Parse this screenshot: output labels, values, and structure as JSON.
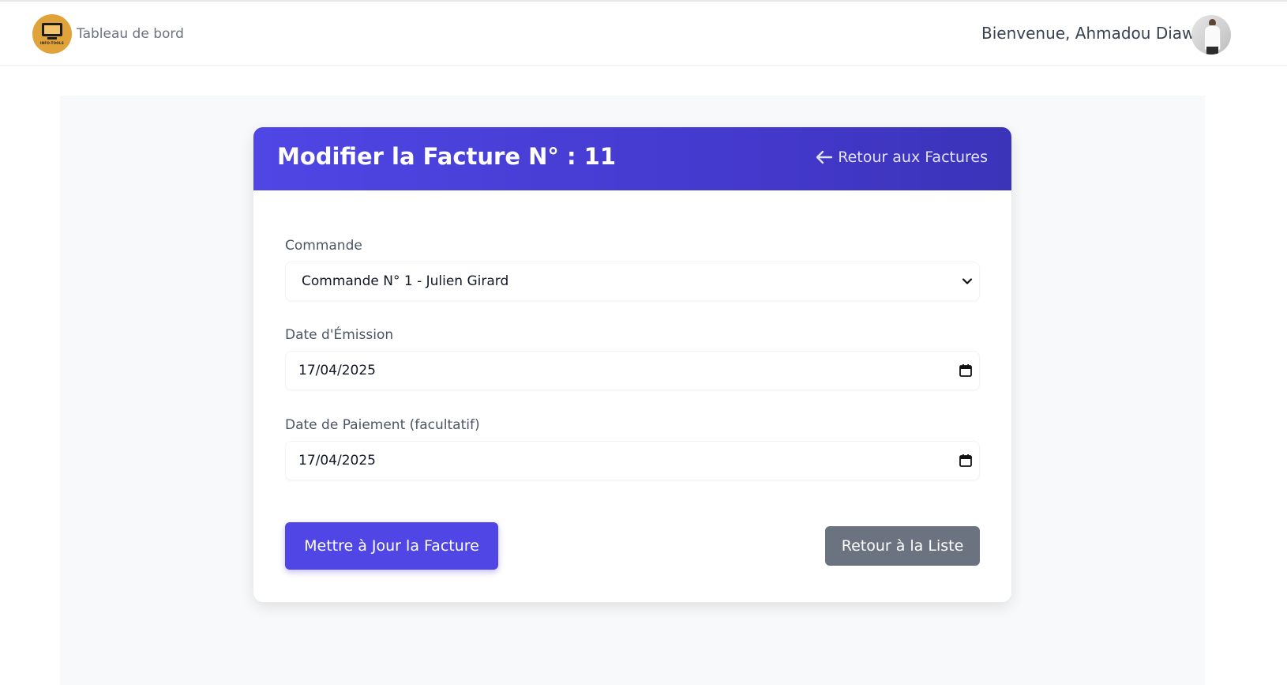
{
  "topbar": {
    "brand_label": "Tableau de bord",
    "logo_text": "INFO-TOOLS",
    "welcome": "Bienvenue, Ahmadou Diaw",
    "avatar_icon": "user-photo",
    "logo_color": "#e0a33a"
  },
  "card": {
    "title": "Modifier la Facture N° : 11",
    "back_link": "Retour aux Factures",
    "header_color": "#4f46e5"
  },
  "form": {
    "commande": {
      "label": "Commande",
      "value": "Commande N° 1 - Julien Girard"
    },
    "date_emission": {
      "label": "Date d'Émission",
      "value": "17/04/2025"
    },
    "date_paiement": {
      "label": "Date de Paiement (facultatif)",
      "value": "17/04/2025"
    },
    "submit_label": "Mettre à Jour la Facture",
    "back_label": "Retour à la Liste",
    "primary_color": "#4f46e5",
    "secondary_color": "#6b7280"
  }
}
